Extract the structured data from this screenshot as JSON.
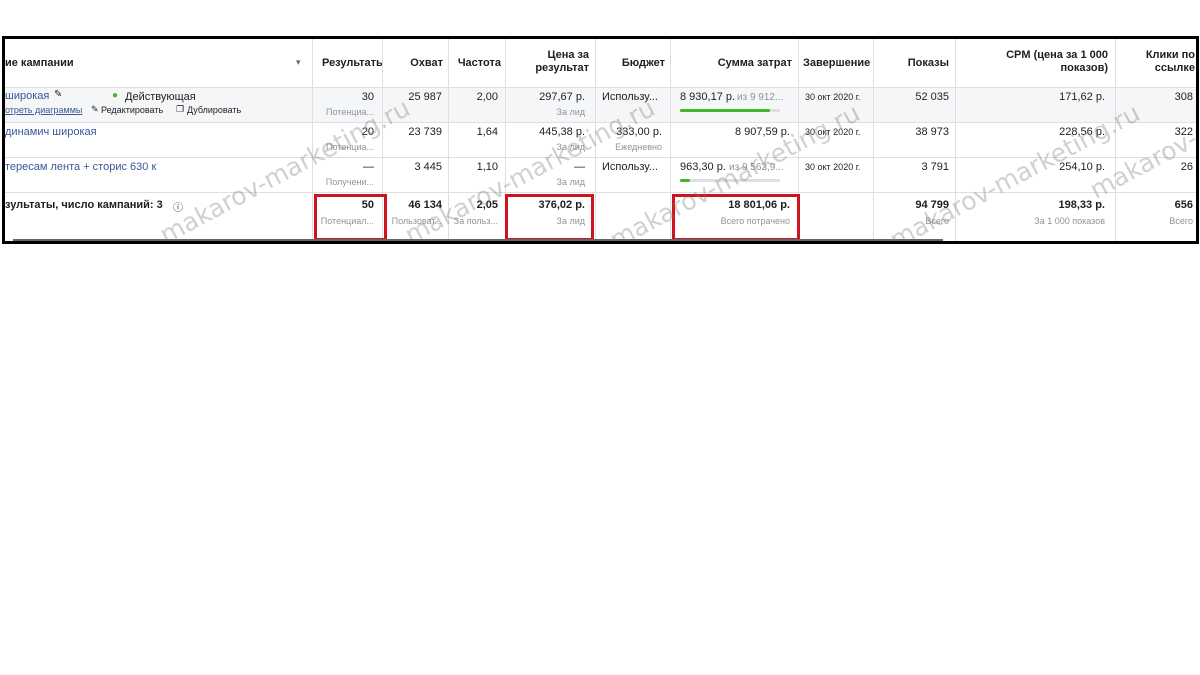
{
  "headers": {
    "name": "ие кампании",
    "results": "Результаты",
    "reach": "Охват",
    "frequency": "Частота",
    "cost_per_result": "Цена за результат",
    "budget": "Бюджет",
    "spent": "Сумма затрат",
    "end": "Завершение",
    "impressions": "Показы",
    "cpm": "CPM (цена за 1 000 показов)",
    "clicks": "Клики по ссылке"
  },
  "rows": [
    {
      "name": "широкая",
      "status": "Действующая",
      "actions": [
        "отреть диаграммы",
        "Редактировать",
        "Дублировать"
      ],
      "results": "30",
      "results_sub": "Потенциа...",
      "reach": "25 987",
      "frequency": "2,00",
      "cost": "297,67 р.",
      "cost_sub": "За лид",
      "budget": "Использу...",
      "spent": "8 930,17 р.",
      "spent_of": "из 9 912...",
      "end": "30 окт 2020 г.",
      "impressions": "52 035",
      "cpm": "171,62 р.",
      "clicks": "308",
      "progress": 0.9
    },
    {
      "name": "динамич широкая",
      "results": "20",
      "results_sub": "Потенциа...",
      "reach": "23 739",
      "frequency": "1,64",
      "cost": "445,38 р.",
      "cost_sub": "За лид",
      "budget": "333,00 р.",
      "budget_sub": "Ежедневно",
      "spent": "8 907,59 р.",
      "end": "30 окт 2020 г.",
      "impressions": "38 973",
      "cpm": "228,56 р.",
      "clicks": "322"
    },
    {
      "name": "тересам лента + сторис 630 к",
      "results": "—",
      "results_sub": "Получени...",
      "reach": "3 445",
      "frequency": "1,10",
      "cost": "—",
      "cost_sub": "За лид",
      "budget": "Использу...",
      "spent": "963,30 р.",
      "spent_of": "из 9 562,9...",
      "end": "30 окт 2020 г.",
      "impressions": "3 791",
      "cpm": "254,10 р.",
      "clicks": "26",
      "progress": 0.1
    }
  ],
  "totals": {
    "label": "зультаты, число кампаний: 3",
    "results": "50",
    "results_sub": "Потенциал...",
    "reach": "46 134",
    "reach_sub": "Пользоват...",
    "frequency": "2,05",
    "frequency_sub": "За польз...",
    "cost": "376,02 р.",
    "cost_sub": "За лид",
    "spent": "18 801,06 р.",
    "spent_sub": "Всего потрачено",
    "impressions": "94 799",
    "impressions_sub": "Всего",
    "cpm": "198,33 р.",
    "cpm_sub": "За 1 000 показов",
    "clicks": "656",
    "clicks_sub": "Всего"
  },
  "watermark": "makarov-marketing.ru",
  "colors": {
    "link": "#385898",
    "highlight": "#d0121e",
    "status_dot": "#42b72a",
    "progress": "#42b72a"
  }
}
